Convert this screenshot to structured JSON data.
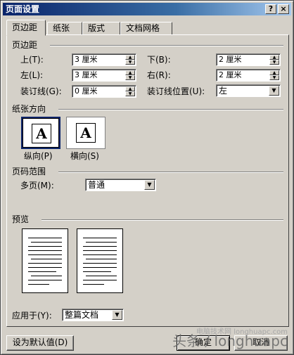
{
  "window": {
    "title": "页面设置",
    "help_label": "?",
    "close_label": "×"
  },
  "tabs": [
    {
      "label": "页边距",
      "active": true
    },
    {
      "label": "纸张",
      "active": false
    },
    {
      "label": "版式",
      "active": false
    },
    {
      "label": "文档网格",
      "active": false
    }
  ],
  "margins": {
    "group_label": "页边距",
    "top": {
      "label": "上(T):",
      "value": "3 厘米"
    },
    "bottom": {
      "label": "下(B):",
      "value": "2 厘米"
    },
    "left": {
      "label": "左(L):",
      "value": "3 厘米"
    },
    "right": {
      "label": "右(R):",
      "value": "2 厘米"
    },
    "gutter": {
      "label": "装订线(G):",
      "value": "0 厘米"
    },
    "gutter_pos": {
      "label": "装订线位置(U):",
      "value": "左"
    }
  },
  "orientation": {
    "group_label": "纸张方向",
    "portrait": {
      "label": "纵向(P)",
      "glyph": "A"
    },
    "landscape": {
      "label": "横向(S)",
      "glyph": "A"
    },
    "selected": "portrait"
  },
  "pages": {
    "group_label": "页码范围",
    "multiple": {
      "label": "多页(M):",
      "value": "普通"
    }
  },
  "preview": {
    "group_label": "预览"
  },
  "apply_to": {
    "label": "应用于(Y):",
    "value": "整篇文档"
  },
  "buttons": {
    "default": "设为默认值(D)",
    "ok": "确定",
    "cancel": "取消"
  },
  "watermark": {
    "text": "头条 / longhuapc",
    "small": "电脑技术网 longhuapc.com"
  }
}
